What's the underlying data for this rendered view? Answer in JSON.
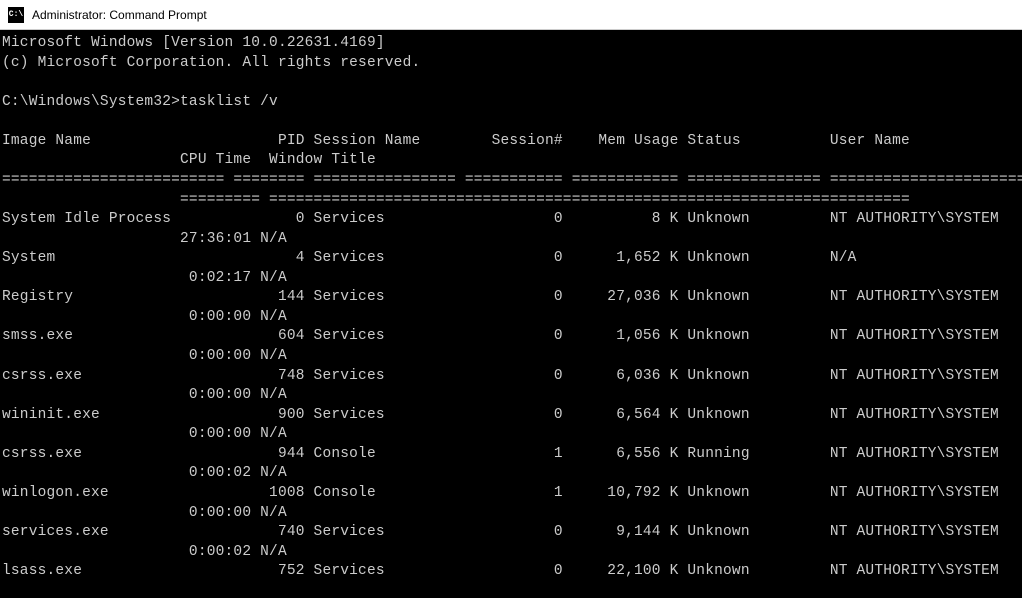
{
  "titlebar": {
    "icon_label": "C:\\",
    "title": "Administrator: Command Prompt"
  },
  "header": {
    "line1": "Microsoft Windows [Version 10.0.22631.4169]",
    "line2": "(c) Microsoft Corporation. All rights reserved."
  },
  "prompt": {
    "path": "C:\\Windows\\System32>",
    "command": "tasklist /v"
  },
  "columns": {
    "row1": {
      "image_name": "Image Name",
      "pid": "PID",
      "session_name": "Session Name",
      "session_num": "Session#",
      "mem_usage": "Mem Usage",
      "status": "Status",
      "user_name": "User Name"
    },
    "row2": {
      "cpu_time": "CPU Time",
      "window_title": "Window Title"
    }
  },
  "separator": "========================= ======== ================ =========== ============ =============== ========================",
  "processes": [
    {
      "image_name": "System Idle Process",
      "pid": "0",
      "session_name": "Services",
      "session_num": "0",
      "mem_usage": "8 K",
      "status": "Unknown",
      "user_name": "NT AUTHORITY\\SYSTEM",
      "cpu_time": "27:36:01",
      "window_title": "N/A"
    },
    {
      "image_name": "System",
      "pid": "4",
      "session_name": "Services",
      "session_num": "0",
      "mem_usage": "1,652 K",
      "status": "Unknown",
      "user_name": "N/A",
      "cpu_time": "0:02:17",
      "window_title": "N/A"
    },
    {
      "image_name": "Registry",
      "pid": "144",
      "session_name": "Services",
      "session_num": "0",
      "mem_usage": "27,036 K",
      "status": "Unknown",
      "user_name": "NT AUTHORITY\\SYSTEM",
      "cpu_time": "0:00:00",
      "window_title": "N/A"
    },
    {
      "image_name": "smss.exe",
      "pid": "604",
      "session_name": "Services",
      "session_num": "0",
      "mem_usage": "1,056 K",
      "status": "Unknown",
      "user_name": "NT AUTHORITY\\SYSTEM",
      "cpu_time": "0:00:00",
      "window_title": "N/A"
    },
    {
      "image_name": "csrss.exe",
      "pid": "748",
      "session_name": "Services",
      "session_num": "0",
      "mem_usage": "6,036 K",
      "status": "Unknown",
      "user_name": "NT AUTHORITY\\SYSTEM",
      "cpu_time": "0:00:00",
      "window_title": "N/A"
    },
    {
      "image_name": "wininit.exe",
      "pid": "900",
      "session_name": "Services",
      "session_num": "0",
      "mem_usage": "6,564 K",
      "status": "Unknown",
      "user_name": "NT AUTHORITY\\SYSTEM",
      "cpu_time": "0:00:00",
      "window_title": "N/A"
    },
    {
      "image_name": "csrss.exe",
      "pid": "944",
      "session_name": "Console",
      "session_num": "1",
      "mem_usage": "6,556 K",
      "status": "Running",
      "user_name": "NT AUTHORITY\\SYSTEM",
      "cpu_time": "0:00:02",
      "window_title": "N/A"
    },
    {
      "image_name": "winlogon.exe",
      "pid": "1008",
      "session_name": "Console",
      "session_num": "1",
      "mem_usage": "10,792 K",
      "status": "Unknown",
      "user_name": "NT AUTHORITY\\SYSTEM",
      "cpu_time": "0:00:00",
      "window_title": "N/A"
    },
    {
      "image_name": "services.exe",
      "pid": "740",
      "session_name": "Services",
      "session_num": "0",
      "mem_usage": "9,144 K",
      "status": "Unknown",
      "user_name": "NT AUTHORITY\\SYSTEM",
      "cpu_time": "0:00:02",
      "window_title": "N/A"
    },
    {
      "image_name": "lsass.exe",
      "pid": "752",
      "session_name": "Services",
      "session_num": "0",
      "mem_usage": "22,100 K",
      "status": "Unknown",
      "user_name": "NT AUTHORITY\\SYSTEM",
      "cpu_time": "",
      "window_title": ""
    }
  ]
}
